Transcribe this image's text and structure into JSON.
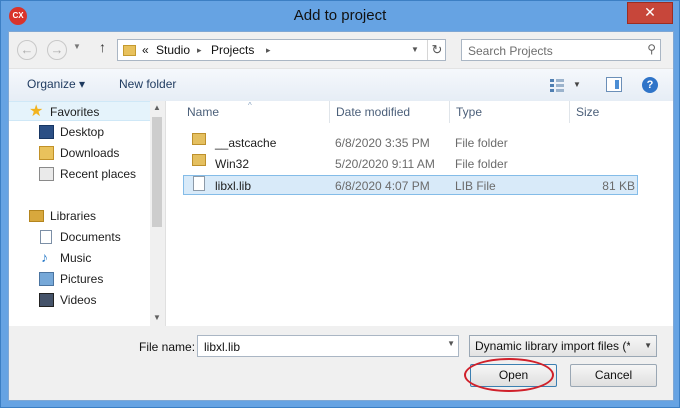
{
  "window": {
    "title": "Add to project",
    "app_icon_text": "CX",
    "close_symbol": "✕"
  },
  "navigation": {
    "back_symbol": "←",
    "forward_symbol": "→",
    "up_symbol": "↑",
    "breadcrumb_prefix": "«",
    "breadcrumbs": [
      "Studio",
      "Projects"
    ],
    "crumb_separator": "▸",
    "refresh_symbol": "↻",
    "search_placeholder": "Search Projects",
    "search_icon": "search-icon"
  },
  "toolbar": {
    "organize_label": "Organize ▾",
    "new_folder_label": "New folder",
    "help_symbol": "?"
  },
  "nav_pane": {
    "favorites_label": "Favorites",
    "favorites": [
      "Desktop",
      "Downloads",
      "Recent places"
    ],
    "libraries_label": "Libraries",
    "libraries": [
      "Documents",
      "Music",
      "Pictures",
      "Videos"
    ]
  },
  "columns": {
    "name": "Name",
    "date_modified": "Date modified",
    "type": "Type",
    "size": "Size"
  },
  "files": [
    {
      "name": "__astcache",
      "date": "6/8/2020 3:35 PM",
      "type": "File folder",
      "size": "",
      "kind": "folder"
    },
    {
      "name": "Win32",
      "date": "5/20/2020 9:11 AM",
      "type": "File folder",
      "size": "",
      "kind": "folder"
    },
    {
      "name": "libxl.lib",
      "date": "6/8/2020 4:07 PM",
      "type": "LIB File",
      "size": "81 KB",
      "kind": "file",
      "selected": true
    }
  ],
  "bottom": {
    "file_name_label": "File name:",
    "file_name_value": "libxl.lib",
    "file_type_value": "Dynamic library import files (*.l",
    "open_label": "Open",
    "cancel_label": "Cancel"
  },
  "colors": {
    "accent": "#d0202a",
    "selection": "#d8eaf9",
    "title_bar": "#66a3e3"
  }
}
